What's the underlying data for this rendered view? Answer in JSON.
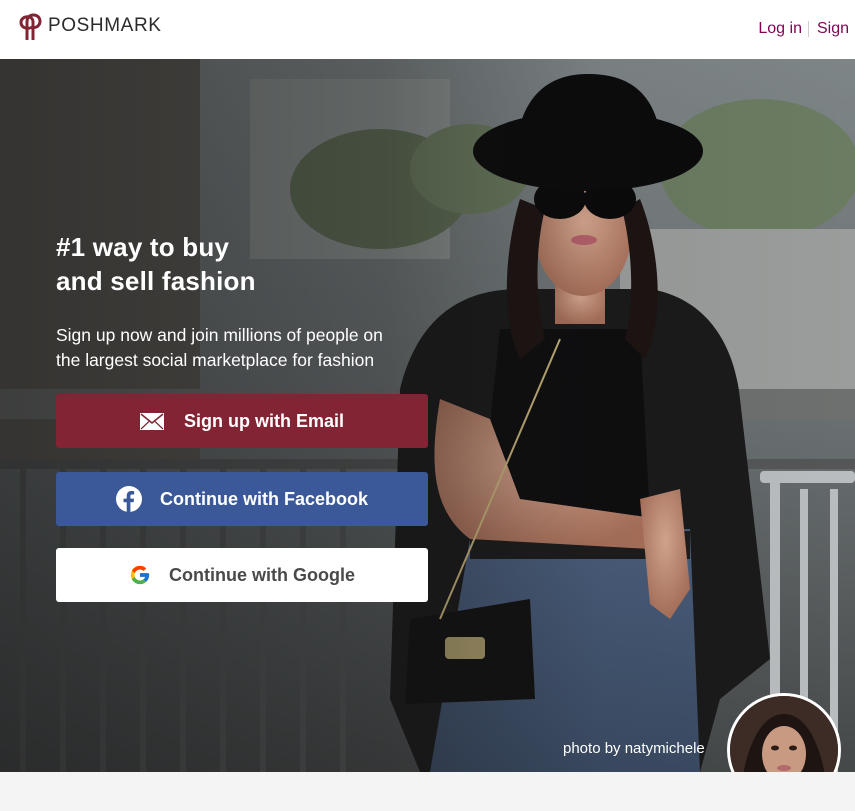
{
  "brand": {
    "name": "POSHMARK",
    "color": "#822433",
    "icon": "poshmark-logo-icon"
  },
  "nav": {
    "login": "Log in",
    "signup": "Sign"
  },
  "hero": {
    "title_line1": "#1 way to buy",
    "title_line2": "and sell fashion",
    "subtitle_line1": "Sign up now and join millions of people on",
    "subtitle_line2": "the largest social marketplace for fashion",
    "photo_credit": "photo by natymichele"
  },
  "buttons": {
    "email": {
      "label": "Sign up with Email",
      "icon": "envelope-icon",
      "color": "#822433"
    },
    "facebook": {
      "label": "Continue with Facebook",
      "icon": "facebook-icon",
      "color": "#3b5998"
    },
    "google": {
      "label": "Continue with Google",
      "icon": "google-icon",
      "color": "#ffffff"
    }
  }
}
